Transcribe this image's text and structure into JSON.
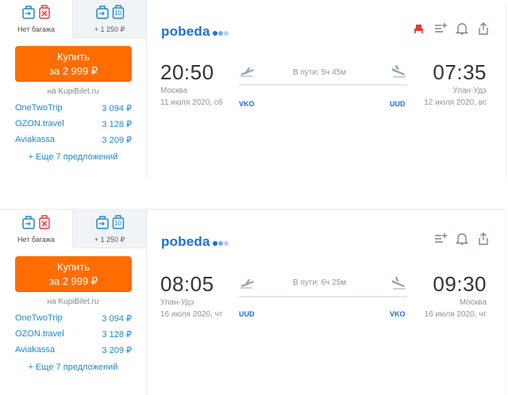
{
  "colors": {
    "accent_orange": "#ff6d00",
    "link_blue": "#1e88c7",
    "brand_blue": "#1e6fd9",
    "muted": "#8a95a0"
  },
  "cards": [
    {
      "baggage": {
        "no_bag_label": "Нет багажа",
        "with_bag_label": "+ 1 250 ₽",
        "with_bag_weight": "10"
      },
      "buy": {
        "label": "Купить",
        "price": "за 2 999 ₽"
      },
      "site": "на KupiBilet.ru",
      "offers": [
        {
          "name": "OneTwoTrip",
          "price": "3 094 ₽"
        },
        {
          "name": "OZON.travel",
          "price": "3 128 ₽"
        },
        {
          "name": "Aviakassa",
          "price": "3 209 ₽"
        }
      ],
      "more_offers": "+ Еще 7 предложений",
      "airline": "pobeda",
      "tools": [
        "seat-icon",
        "add-to-list-icon",
        "bell-icon",
        "share-icon"
      ],
      "depart": {
        "time": "20:50",
        "city": "Москва",
        "date": "11 июля 2020, сб",
        "iata": "VKO"
      },
      "duration": "В пути: 5ч 45м",
      "arrive": {
        "time": "07:35",
        "city": "Улан-Удэ",
        "date": "12 июля 2020, вс",
        "iata": "UUD"
      }
    },
    {
      "baggage": {
        "no_bag_label": "Нет багажа",
        "with_bag_label": "+ 1 250 ₽",
        "with_bag_weight": "10"
      },
      "buy": {
        "label": "Купить",
        "price": "за 2 999 ₽"
      },
      "site": "на KupiBilet.ru",
      "offers": [
        {
          "name": "OneTwoTrip",
          "price": "3 094 ₽"
        },
        {
          "name": "OZON.travel",
          "price": "3 128 ₽"
        },
        {
          "name": "Aviakassa",
          "price": "3 209 ₽"
        }
      ],
      "more_offers": "+ Еще 7 предложений",
      "airline": "pobeda",
      "tools": [
        "add-to-list-icon",
        "bell-icon",
        "share-icon"
      ],
      "depart": {
        "time": "08:05",
        "city": "Улан-Удэ",
        "date": "16 июля 2020, чт",
        "iata": "UUD"
      },
      "duration": "В пути: 6ч 25м",
      "arrive": {
        "time": "09:30",
        "city": "Москва",
        "date": "16 июля 2020, чт",
        "iata": "VKO"
      }
    }
  ]
}
